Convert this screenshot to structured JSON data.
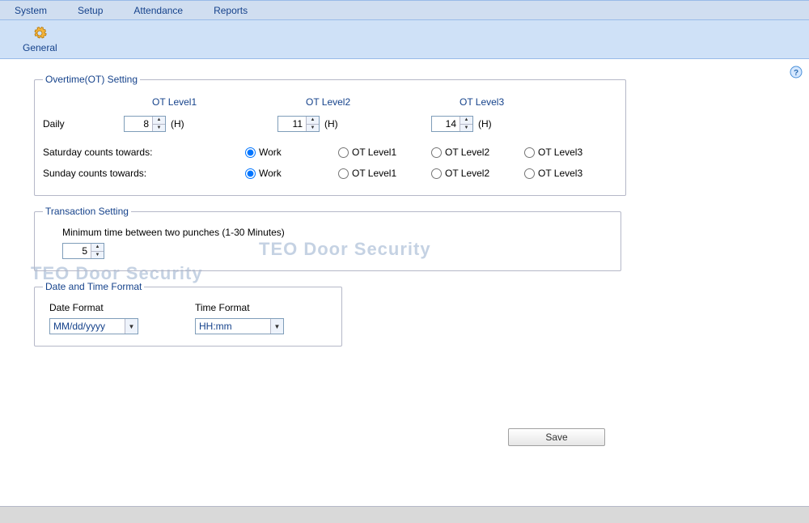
{
  "menu": {
    "items": [
      "System",
      "Setup",
      "Attendance",
      "Reports"
    ]
  },
  "toolbar": {
    "general": "General"
  },
  "watermark": "TEO Door Security",
  "overtime": {
    "legend": "Overtime(OT) Setting",
    "headers": {
      "l1": "OT Level1",
      "l2": "OT Level2",
      "l3": "OT Level3"
    },
    "daily_label": "Daily",
    "hours_suffix": "(H)",
    "daily": {
      "l1": "8",
      "l2": "11",
      "l3": "14"
    },
    "saturday_label": "Saturday counts towards:",
    "sunday_label": "Sunday counts towards:",
    "radio_options": {
      "work": "Work",
      "l1": "OT Level1",
      "l2": "OT Level2",
      "l3": "OT Level3"
    }
  },
  "transaction": {
    "legend": "Transaction Setting",
    "min_label": "Minimum time between two punches (1-30 Minutes)",
    "min_value": "5"
  },
  "datetime": {
    "legend": "Date and Time Format",
    "date_label": "Date Format",
    "time_label": "Time Format",
    "date_value": "MM/dd/yyyy",
    "time_value": "HH:mm"
  },
  "save_label": "Save"
}
